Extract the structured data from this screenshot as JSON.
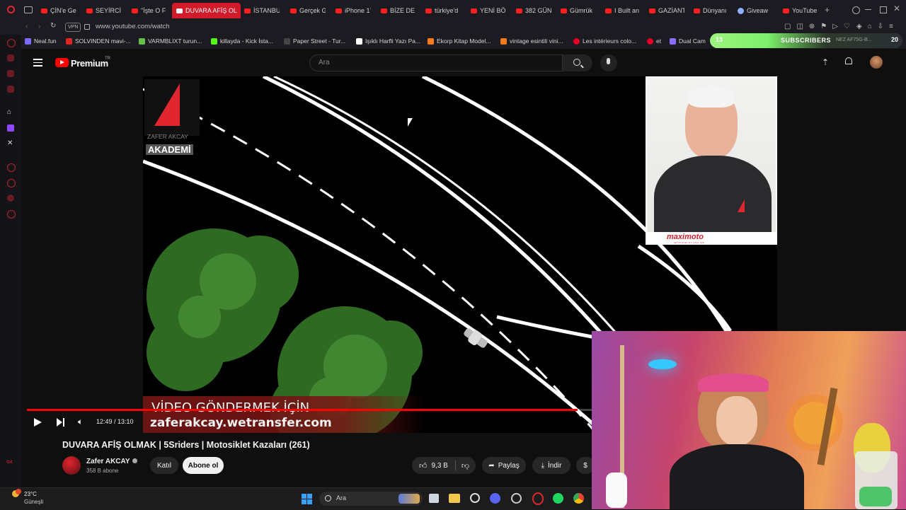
{
  "browser": {
    "tabs": [
      {
        "label": "ÇİN'e Ge"
      },
      {
        "label": "SEYİRCİ"
      },
      {
        "label": "\"İşte O F"
      },
      {
        "label": "DUVARA AFİŞ OL",
        "active": true
      },
      {
        "label": "İSTANBU"
      },
      {
        "label": "Gerçek G"
      },
      {
        "label": "iPhone 17"
      },
      {
        "label": "BİZE DE"
      },
      {
        "label": "türkiye'd"
      },
      {
        "label": "YENİ BÖ"
      },
      {
        "label": "382 GÜN"
      },
      {
        "label": "Gümrük"
      },
      {
        "label": "I Built an"
      },
      {
        "label": "GAZİANT"
      },
      {
        "label": "Dünyanı"
      },
      {
        "label": "Giveaw"
      },
      {
        "label": "YouTube"
      }
    ],
    "new_tab_symbol": "+",
    "vpn_badge": "VPN",
    "url": "www.youtube.com/watch",
    "bookmarks": [
      {
        "label": "Neal.fun"
      },
      {
        "label": "SOLVINDEN mavi-..."
      },
      {
        "label": "VARMBLIXT turun..."
      },
      {
        "label": "killayda - Kick İsta..."
      },
      {
        "label": "Paper Street - Tur..."
      },
      {
        "label": "Işıklı Harfli Yazı Pa..."
      },
      {
        "label": "Ekorp Kitap Model..."
      },
      {
        "label": "vintage esintili vini..."
      },
      {
        "label": "Les intérieurs colo..."
      },
      {
        "label": "et"
      },
      {
        "label": "Dual Cam"
      }
    ],
    "subscriber_overlay": {
      "label": "SUBSCRIBERS",
      "count_left": "13",
      "count_right": "20",
      "text_right": "NEZ AF75G-B..."
    }
  },
  "youtube": {
    "logo_text": "Premium",
    "logo_badge": "TR",
    "search_placeholder": "Ara",
    "video": {
      "channel_logo_caption": "ZAFER AKCAY",
      "channel_logo_academy": "AKADEMİ",
      "overlay_line1": "VİDEO GÖNDERMEK İÇİN",
      "overlay_line2": "zaferakcay.wetransfer.com",
      "inset_brand": "maximoto",
      "inset_brand_sub": "MOTOSİKLET YAKLARI",
      "time": "12:49 / 13:10",
      "progress": 0.975
    },
    "title": "DUVARA AFİŞ OLMAK | 5Sriders | Motosiklet Kazaları (261)",
    "channel": {
      "name": "Zafer AKCAY",
      "subs": "358 B abone"
    },
    "join_label": "Katıl",
    "subscribe_label": "Abone ol",
    "like_count": "9,3 B",
    "share_label": "Paylaş",
    "download_label": "İndir"
  },
  "taskbar": {
    "temperature": "23°C",
    "weather": "Güneşli",
    "search_label": "Ara"
  },
  "colors": {
    "yt_red": "#ff0000",
    "opera_red": "#d11a2a",
    "subscribe_bg": "#f1f1f1",
    "overlay_green": "#7cf06b"
  }
}
